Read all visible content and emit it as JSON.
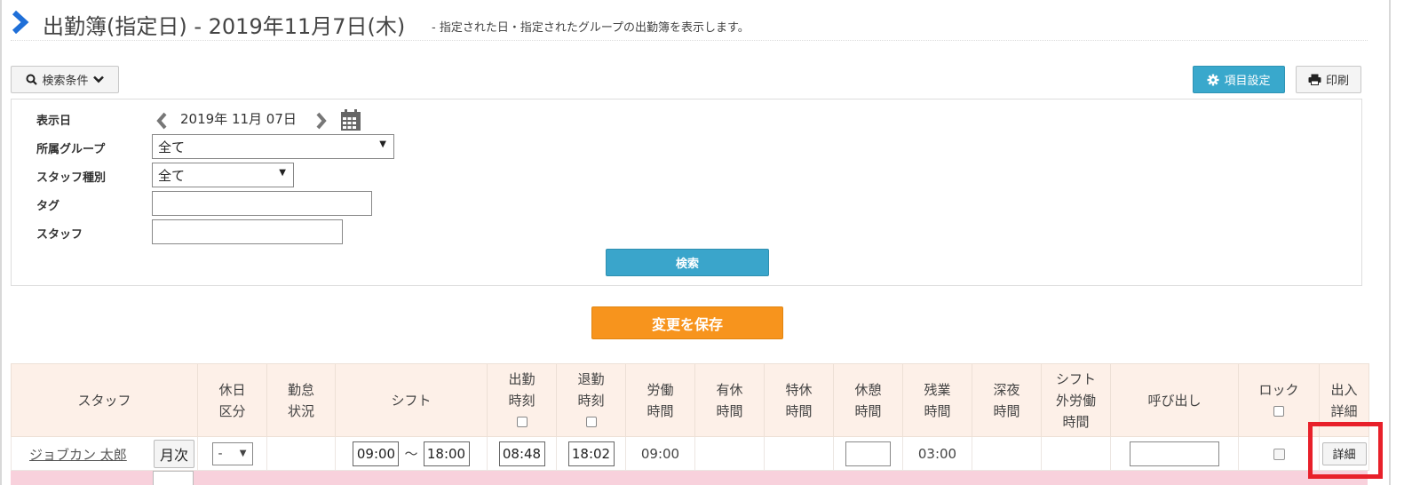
{
  "header": {
    "title": "出勤簿(指定日) - 2019年11月7日(木)",
    "subtitle": "- 指定された日・指定されたグループの出勤簿を表示します。"
  },
  "toolbar": {
    "search_conditions_label": "検索条件",
    "config_label": "項目設定",
    "print_label": "印刷"
  },
  "search": {
    "display_date_label": "表示日",
    "display_date_value": "2019年 11月 07日",
    "group_label": "所属グループ",
    "group_value": "全て",
    "staff_type_label": "スタッフ種別",
    "staff_type_value": "全て",
    "tag_label": "タグ",
    "tag_value": "",
    "staff_label": "スタッフ",
    "staff_value": "",
    "search_button": "検索"
  },
  "save_button": "変更を保存",
  "table": {
    "headers": {
      "staff": "スタッフ",
      "holiday_type_1": "休日",
      "holiday_type_2": "区分",
      "attendance_status_1": "勤怠",
      "attendance_status_2": "状況",
      "shift": "シフト",
      "clock_in_1": "出勤",
      "clock_in_2": "時刻",
      "clock_out_1": "退勤",
      "clock_out_2": "時刻",
      "work_hours_1": "労働",
      "work_hours_2": "時間",
      "paid_leave_1": "有休",
      "paid_leave_2": "時間",
      "special_leave_1": "特休",
      "special_leave_2": "時間",
      "break_1": "休憩",
      "break_2": "時間",
      "overtime_1": "残業",
      "overtime_2": "時間",
      "late_night_1": "深夜",
      "late_night_2": "時間",
      "off_shift_1": "シフト",
      "off_shift_2": "外労働",
      "off_shift_3": "時間",
      "callout": "呼び出し",
      "lock": "ロック",
      "access_detail_1": "出入",
      "access_detail_2": "詳細"
    },
    "row": {
      "staff_name": "ジョブカン 太郎",
      "monthly_button": "月次",
      "holiday_type": "-",
      "shift_start": "09:00",
      "shift_separator": "～",
      "shift_end": "18:00",
      "clock_in": "08:48",
      "clock_out": "18:02",
      "work_hours": "09:00",
      "paid_leave": "",
      "special_leave": "",
      "break": "",
      "overtime": "03:00",
      "late_night": "",
      "off_shift": "",
      "callout": "",
      "detail_button": "詳細"
    }
  },
  "colors": {
    "accent_blue": "#39a8cc",
    "save_orange": "#f7941d",
    "header_bg": "#fdf0e8",
    "highlight_red": "#e8202a",
    "row_pink": "#f8d1dc"
  }
}
